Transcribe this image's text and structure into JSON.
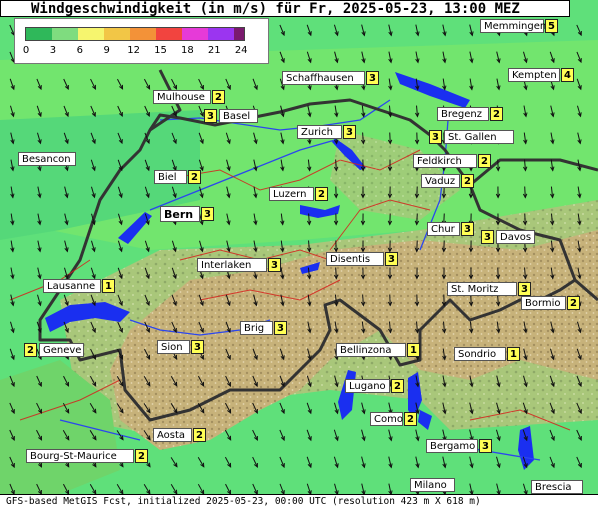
{
  "title": "Windgeschwindigkeit (in m/s) für Fr, 2025-05-23, 13:00 MEZ",
  "footer": "GFS-based MetGIS Fcst, initialized 2025-05-23, 00:00 UTC  (resolution 423 m X 618 m)",
  "legend": {
    "ticks": [
      "0",
      "3",
      "6",
      "9",
      "12",
      "15",
      "18",
      "21",
      "24"
    ],
    "colors": [
      "#2fb85a",
      "#7fdc7f",
      "#f6f56e",
      "#f2c646",
      "#f39238",
      "#f2443f",
      "#e63ad8",
      "#9b35f0",
      "#7a1a6e"
    ]
  },
  "locations": [
    {
      "name": "Memmingen",
      "value": "5"
    },
    {
      "name": "Schaffhausen",
      "value": "3"
    },
    {
      "name": "Kempten",
      "value": "4"
    },
    {
      "name": "Mulhouse",
      "value": "2"
    },
    {
      "name": "Basel",
      "value": "3"
    },
    {
      "name": "Bregenz",
      "value": "2"
    },
    {
      "name": "Zurich",
      "value": "3"
    },
    {
      "name": "St. Gallen",
      "value": "3"
    },
    {
      "name": "Besancon",
      "value": ""
    },
    {
      "name": "Feldkirch",
      "value": "2"
    },
    {
      "name": "Vaduz",
      "value": "2"
    },
    {
      "name": "Biel",
      "value": "2"
    },
    {
      "name": "Luzern",
      "value": "2"
    },
    {
      "name": "Bern",
      "value": "3"
    },
    {
      "name": "Chur",
      "value": "3"
    },
    {
      "name": "Davos",
      "value": "3"
    },
    {
      "name": "Interlaken",
      "value": "3"
    },
    {
      "name": "Disentis",
      "value": "3"
    },
    {
      "name": "Lausanne",
      "value": "1"
    },
    {
      "name": "St. Moritz",
      "value": "3"
    },
    {
      "name": "Bormio",
      "value": "2"
    },
    {
      "name": "Brig",
      "value": "3"
    },
    {
      "name": "Sion",
      "value": "3"
    },
    {
      "name": "Geneve",
      "value": "2"
    },
    {
      "name": "Bellinzona",
      "value": "1"
    },
    {
      "name": "Sondrio",
      "value": "1"
    },
    {
      "name": "Lugano",
      "value": "2"
    },
    {
      "name": "Como",
      "value": "2"
    },
    {
      "name": "Aosta",
      "value": "2"
    },
    {
      "name": "Bergamo",
      "value": "3"
    },
    {
      "name": "Bourg-St-Maurice",
      "value": "2"
    },
    {
      "name": "Milano",
      "value": ""
    },
    {
      "name": "Brescia",
      "value": ""
    }
  ]
}
